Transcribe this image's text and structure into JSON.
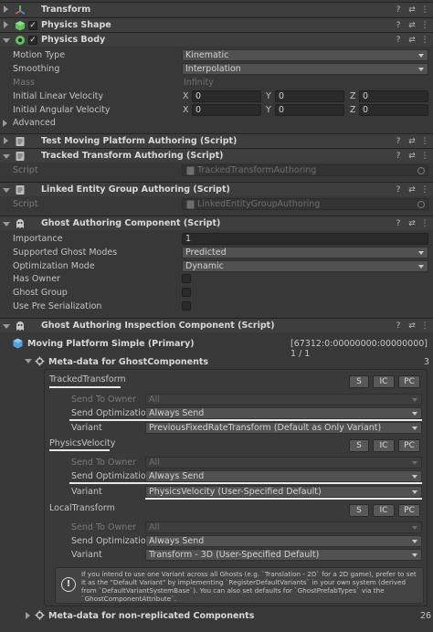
{
  "components": {
    "transform": {
      "title": "Transform"
    },
    "physics_shape": {
      "title": "Physics Shape",
      "checked": "✓"
    },
    "physics_body": {
      "title": "Physics Body",
      "checked": "✓"
    },
    "test_moving": {
      "title": "Test Moving Platform Authoring (Script)"
    },
    "tracked_transform": {
      "title": "Tracked Transform Authoring (Script)",
      "script_label": "Script",
      "script_value": "TrackedTransformAuthoring"
    },
    "linked_entity": {
      "title": "Linked Entity Group Authoring (Script)",
      "script_label": "Script",
      "script_value": "LinkedEntityGroupAuthoring"
    },
    "ghost_authoring": {
      "title": "Ghost Authoring Component (Script)"
    },
    "ghost_inspection": {
      "title": "Ghost Authoring Inspection Component (Script)"
    }
  },
  "physics_body": {
    "motion_type": {
      "label": "Motion Type",
      "value": "Kinematic"
    },
    "smoothing": {
      "label": "Smoothing",
      "value": "Interpolation"
    },
    "mass": {
      "label": "Mass",
      "value": "Infinity"
    },
    "linear_velocity": {
      "label": "Initial Linear Velocity",
      "x": "0",
      "y": "0",
      "z": "0"
    },
    "angular_velocity": {
      "label": "Initial Angular Velocity",
      "x": "0",
      "y": "0",
      "z": "0"
    },
    "advanced": "Advanced"
  },
  "axes": {
    "x": "X",
    "y": "Y",
    "z": "Z"
  },
  "ghost": {
    "importance": {
      "label": "Importance",
      "value": "1"
    },
    "supported_modes": {
      "label": "Supported Ghost Modes",
      "value": "Predicted"
    },
    "optimization_mode": {
      "label": "Optimization Mode",
      "value": "Dynamic"
    },
    "has_owner": "Has Owner",
    "ghost_group": "Ghost Group",
    "pre_serialization": "Use Pre Serialization"
  },
  "inspection": {
    "prefab_name": "Moving Platform Simple (Primary)",
    "prefab_hash": "[67312:0:00000000:00000000] 1 / 1",
    "meta_title": "Meta-data for GhostComponents",
    "meta_count": "3",
    "row_labels": {
      "send_to_owner": "Send To Owner",
      "send_optimization": "Send Optimization",
      "variant": "Variant"
    },
    "buttons": {
      "s": "S",
      "ic": "IC",
      "pc": "PC"
    },
    "components": [
      {
        "name": "TrackedTransform",
        "send_to_owner": "All",
        "send_optimization": "Always Send",
        "variant": "PreviousFixedRateTransform (Default as Only Variant)"
      },
      {
        "name": "PhysicsVelocity",
        "send_to_owner": "All",
        "send_optimization": "Always Send",
        "variant": "PhysicsVelocity (User-Specified Default)"
      },
      {
        "name": "LocalTransform",
        "send_to_owner": "All",
        "send_optimization": "Always Send",
        "variant": "Transform - 3D (User-Specified Default)"
      }
    ],
    "info_text": "If you intend to use one Variant across all Ghosts (e.g. `Translation - 2D` for a 2D game), prefer to set it as the \"Default Variant\" by implementing `RegisterDefaultVariants` in your own system (derived from `DefaultVariantSystemBase`). You can also set defaults for `GhostPrefabTypes` via the `GhostComponentAttribute`.",
    "nonrep_title": "Meta-data for non-replicated Components",
    "nonrep_count": "26"
  },
  "icons": {
    "help": "?",
    "settings": "⇄",
    "menu": "⋮"
  },
  "colors": {
    "background": "#383838",
    "header": "#3e3e3e",
    "field": "#2a2a2a",
    "accent_teal": "#3fbfa8",
    "prefab_blue": "#4fa3e0"
  }
}
